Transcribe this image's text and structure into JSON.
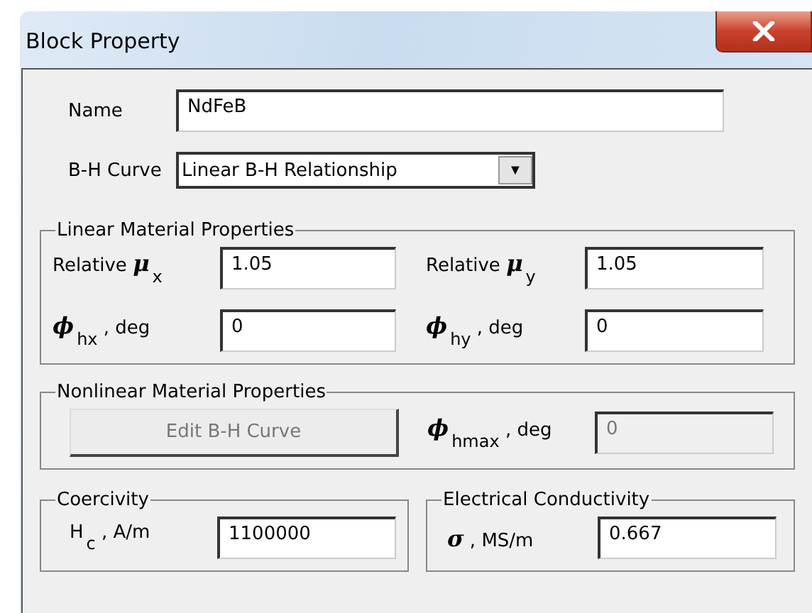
{
  "window": {
    "title": "Block Property"
  },
  "name": {
    "label": "Name",
    "value": "NdFeB"
  },
  "bh_curve": {
    "label": "B-H Curve",
    "value": "Linear B-H Relationship",
    "arrow": "▼"
  },
  "linear_group": {
    "title": "Linear Material Properties",
    "fields": [
      {
        "label": "Relative **μ**$_{x}$",
        "value": "1.05"
      },
      {
        "label": "Relative **μ**$_{y}$",
        "value": "1.05"
      },
      {
        "label": "**ϕ**$_{hx}$ , deg",
        "value": "0"
      },
      {
        "label": "**ϕ**$_{hy}$ , deg",
        "value": "0"
      }
    ]
  },
  "nonlinear_group": {
    "title": "Nonlinear Material Properties",
    "button": {
      "label": "Edit B-H Curve",
      "disabled": true
    },
    "field": {
      "label": "**ϕ**$_{hmax}$ , deg",
      "value": "0",
      "disabled": true
    }
  },
  "coercivity_group": {
    "title": "Coercivity",
    "field": {
      "label": "H$_{c}$ , A/m",
      "value": "1100000"
    }
  },
  "conductivity_group": {
    "title": "Electrical Conductivity",
    "field": {
      "label": "**σ** , MS/m",
      "value": "0.667"
    }
  }
}
